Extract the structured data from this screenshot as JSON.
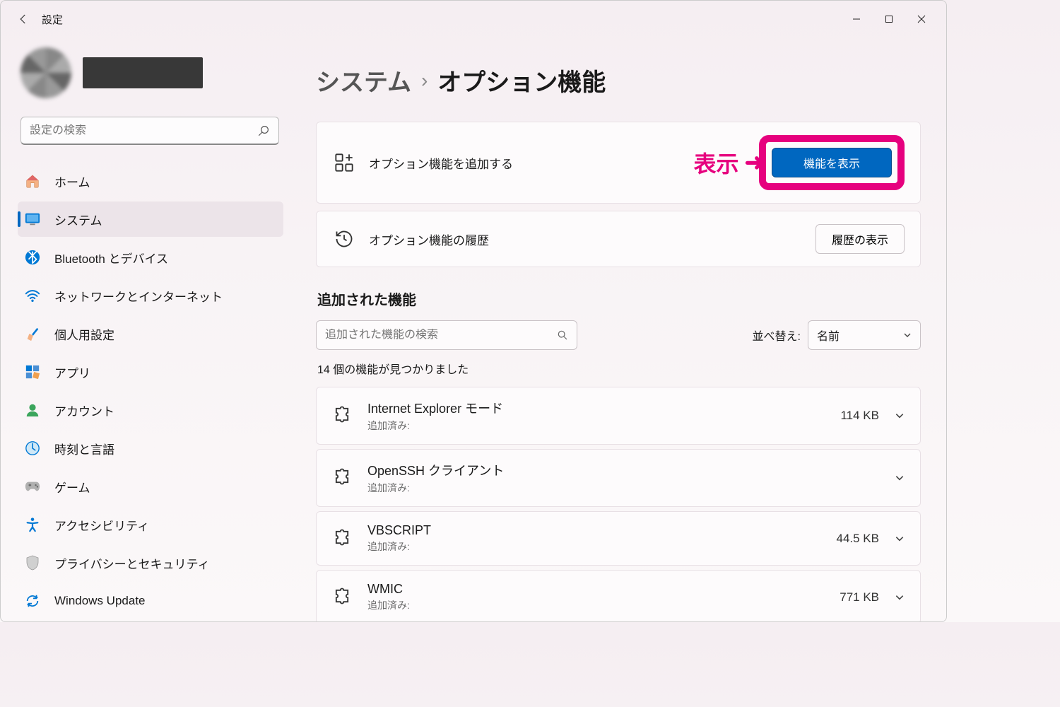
{
  "titlebar": {
    "title": "設定"
  },
  "sidebar": {
    "search_placeholder": "設定の検索",
    "items": [
      {
        "label": "ホーム"
      },
      {
        "label": "システム"
      },
      {
        "label": "Bluetooth とデバイス"
      },
      {
        "label": "ネットワークとインターネット"
      },
      {
        "label": "個人用設定"
      },
      {
        "label": "アプリ"
      },
      {
        "label": "アカウント"
      },
      {
        "label": "時刻と言語"
      },
      {
        "label": "ゲーム"
      },
      {
        "label": "アクセシビリティ"
      },
      {
        "label": "プライバシーとセキュリティ"
      },
      {
        "label": "Windows Update"
      }
    ]
  },
  "breadcrumb": {
    "parent": "システム",
    "current": "オプション機能"
  },
  "cards": {
    "add": {
      "label": "オプション機能を追加する",
      "button": "機能を表示"
    },
    "history": {
      "label": "オプション機能の履歴",
      "button": "履歴の表示"
    }
  },
  "annotation": {
    "text": "表示"
  },
  "section_added": "追加された機能",
  "filter_placeholder": "追加された機能の検索",
  "sort": {
    "label": "並べ替え:",
    "value": "名前"
  },
  "result_count": "14 個の機能が見つかりました",
  "features": [
    {
      "title": "Internet Explorer モード",
      "sub": "追加済み:",
      "size": "114 KB"
    },
    {
      "title": "OpenSSH クライアント",
      "sub": "追加済み:",
      "size": ""
    },
    {
      "title": "VBSCRIPT",
      "sub": "追加済み:",
      "size": "44.5 KB"
    },
    {
      "title": "WMIC",
      "sub": "追加済み:",
      "size": "771 KB"
    }
  ]
}
